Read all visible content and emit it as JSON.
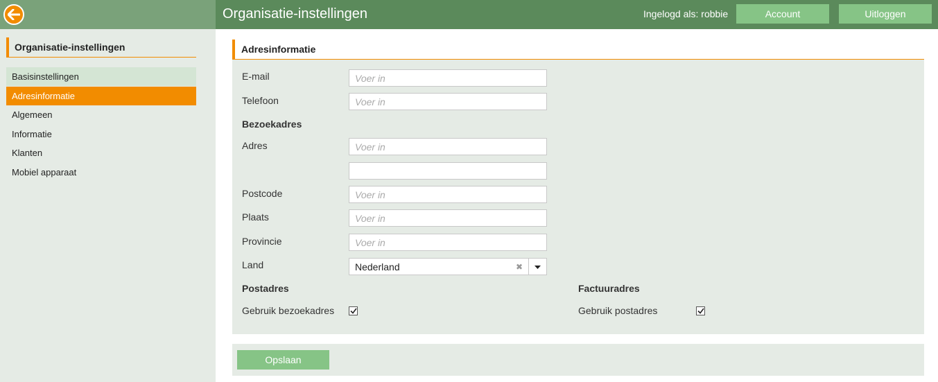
{
  "header": {
    "title": "Organisatie-instellingen",
    "logged_in": "Ingelogd als: robbie",
    "account_label": "Account",
    "logout_label": "Uitloggen"
  },
  "sidebar": {
    "title": "Organisatie-instellingen",
    "items": [
      {
        "label": "Basisinstellingen"
      },
      {
        "label": "Adresinformatie"
      },
      {
        "label": "Algemeen"
      },
      {
        "label": "Informatie"
      },
      {
        "label": "Klanten"
      },
      {
        "label": "Mobiel apparaat"
      }
    ],
    "active_item": "Adresinformatie"
  },
  "form": {
    "title": "Adresinformatie",
    "placeholder": "Voer in",
    "email_label": "E-mail",
    "phone_label": "Telefoon",
    "visit_section": "Bezoekadres",
    "address_label": "Adres",
    "postcode_label": "Postcode",
    "city_label": "Plaats",
    "province_label": "Provincie",
    "country_label": "Land",
    "country_value": "Nederland",
    "postal_section": "Postadres",
    "use_visit_label": "Gebruik bezoekadres",
    "use_visit_checked": true,
    "invoice_section": "Factuuradres",
    "use_postal_label": "Gebruik postadres",
    "use_postal_checked": true
  },
  "footer": {
    "save_label": "Opslaan"
  },
  "colors": {
    "accent": "#f28c00",
    "header": "#5b8a5b",
    "button": "#86c486",
    "panel": "#e5ebe5"
  }
}
